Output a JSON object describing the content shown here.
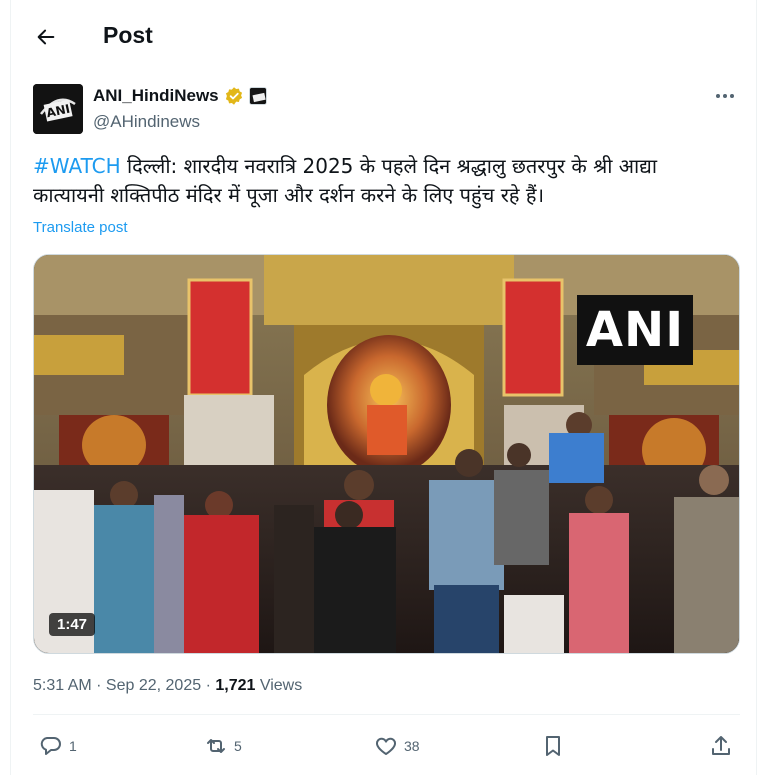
{
  "header": {
    "title": "Post",
    "back_icon": "arrow-left-icon"
  },
  "author": {
    "name": "ANI_HindiNews",
    "handle": "@AHindinews",
    "avatar_text": "ANI",
    "verified_color": "#e2b719"
  },
  "post": {
    "hashtag": "#WATCH",
    "text": " दिल्ली: शारदीय नवरात्रि 2025 के पहले दिन श्रद्धालु छतरपुर के श्री आद्या कात्यायनी शक्तिपीठ मंदिर में पूजा और दर्शन करने के लिए पहुंच रहे हैं।",
    "translate_label": "Translate post"
  },
  "media": {
    "watermark": "ANI",
    "duration": "1:47"
  },
  "meta": {
    "time": "5:31 AM",
    "separator1": " · ",
    "date": "Sep 22, 2025",
    "separator2": " · ",
    "views_count": "1,721",
    "views_label": " Views"
  },
  "actions": {
    "reply_count": "1",
    "repost_count": "5",
    "like_count": "38",
    "bookmark_label": "",
    "share_label": ""
  },
  "colors": {
    "accent": "#1d9bf0",
    "secondary_text": "#536471"
  }
}
